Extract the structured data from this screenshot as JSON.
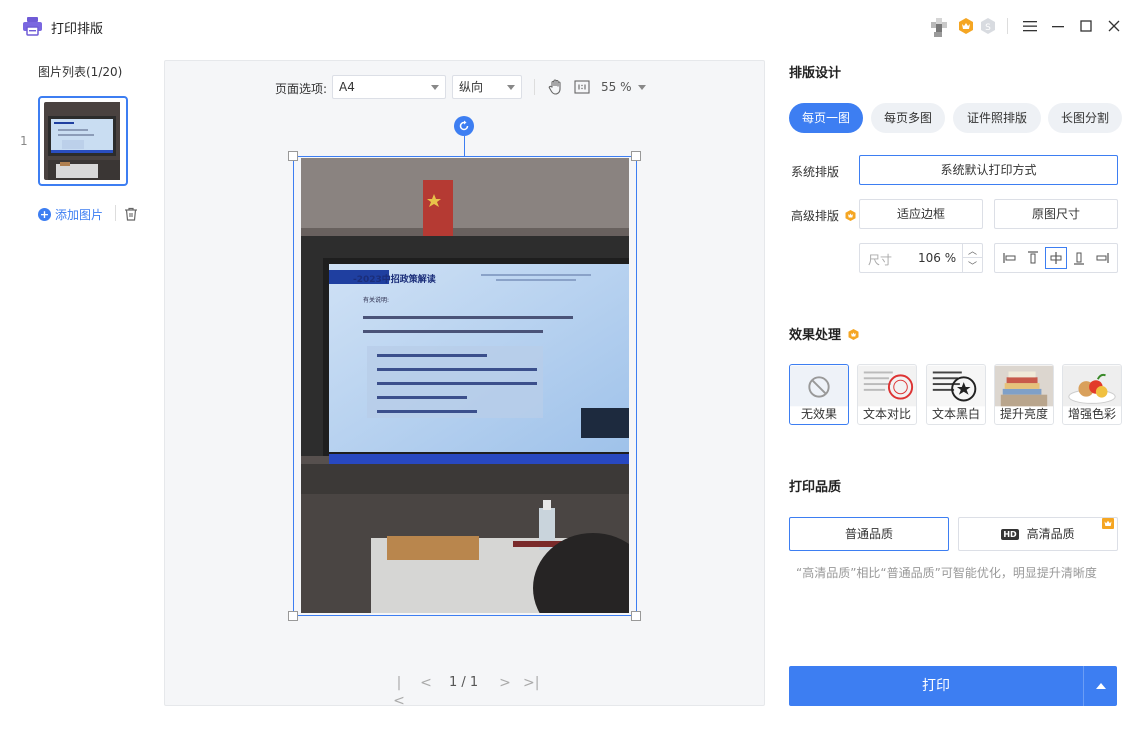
{
  "app": {
    "title": "打印排版"
  },
  "left": {
    "list_title": "图片列表(1/20)",
    "thumb_index": "1",
    "add_image_label": "添加图片"
  },
  "toolbar": {
    "page_option_label": "页面选项:",
    "paper_size": "A4",
    "orientation": "纵向",
    "zoom": "55 %"
  },
  "pager": {
    "text": "1 / 1"
  },
  "layout_design": {
    "title": "排版设计",
    "tabs": [
      {
        "label": "每页一图",
        "active": true
      },
      {
        "label": "每页多图",
        "active": false
      },
      {
        "label": "证件照排版",
        "active": false
      },
      {
        "label": "长图分割",
        "active": false
      }
    ],
    "system_layout_label": "系统排版",
    "system_layout_button": "系统默认打印方式",
    "advanced_layout_label": "高级排版",
    "fit_margin_button": "适应边框",
    "original_size_button": "原图尺寸",
    "size_label": "尺寸",
    "size_value": "106 %"
  },
  "effects": {
    "title": "效果处理",
    "items": [
      {
        "label": "无效果",
        "active": true
      },
      {
        "label": "文本对比",
        "active": false
      },
      {
        "label": "文本黑白",
        "active": false
      },
      {
        "label": "提升亮度",
        "active": false
      },
      {
        "label": "增强色彩",
        "active": false
      }
    ]
  },
  "quality": {
    "title": "打印品质",
    "normal_label": "普通品质",
    "hd_tag": "HD",
    "hd_label": "高清品质",
    "hint": "“高清品质”相比“普通品质”可智能优化，明显提升清晰度"
  },
  "print": {
    "label": "打印"
  },
  "colors": {
    "accent": "#3d7ef2",
    "vip": "#f5a623"
  }
}
